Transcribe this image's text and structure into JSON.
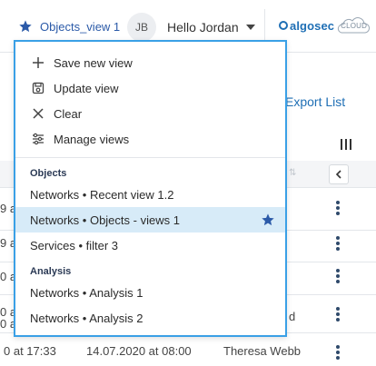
{
  "topbar": {
    "current_view": "Objects_view 1",
    "avatar_initials": "JB",
    "user_greeting": "Hello Jordan",
    "brand_name": "algosec",
    "brand_suffix": "CLOUD"
  },
  "table": {
    "export_label": "Export List",
    "row_fragments": [
      "9 a",
      "9 a",
      "0 a",
      "0 a",
      "0 a"
    ],
    "owner_fragment": "d",
    "last_row": {
      "created": "0 at 17:33",
      "modified": "14.07.2020 at 08:00",
      "owner": "Theresa Webb"
    }
  },
  "dropdown": {
    "actions": [
      {
        "label": "Save new view",
        "icon": "plus-icon"
      },
      {
        "label": "Update view",
        "icon": "save-icon"
      },
      {
        "label": "Clear",
        "icon": "close-icon"
      },
      {
        "label": "Manage views",
        "icon": "sliders-icon"
      }
    ],
    "sections": [
      {
        "title": "Objects",
        "items": [
          {
            "label": "Networks • Recent view 1.2",
            "selected": false
          },
          {
            "label": "Networks • Objects - views 1",
            "selected": true,
            "favorite": true
          },
          {
            "label": "Services • filter 3",
            "selected": false
          }
        ]
      },
      {
        "title": "Analysis",
        "items": [
          {
            "label": "Networks • Analysis 1",
            "selected": false
          },
          {
            "label": "Networks • Analysis 2",
            "selected": false
          }
        ]
      }
    ]
  },
  "colors": {
    "accent": "#3aa0e6",
    "link": "#1f6fb5",
    "selected_bg": "#d7ebf8",
    "star": "#2b5aa8"
  }
}
